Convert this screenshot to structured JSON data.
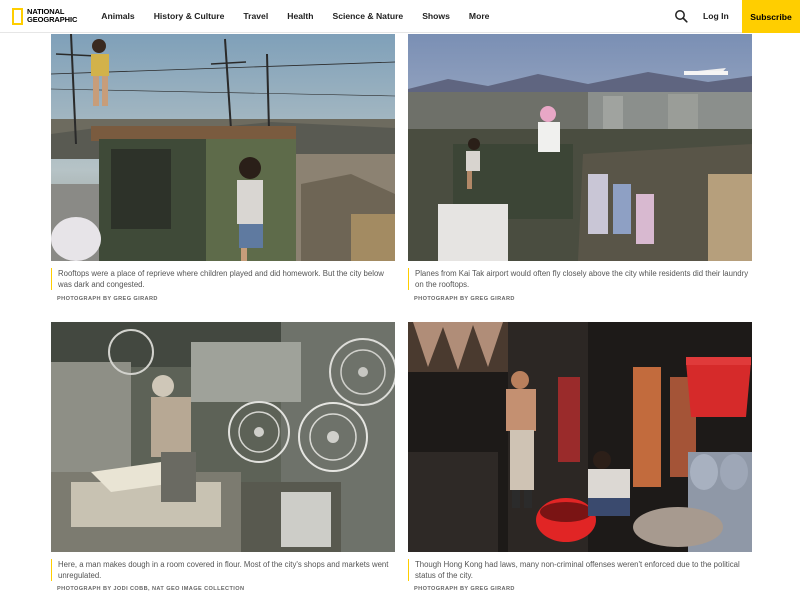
{
  "brand": {
    "logo_line1": "NATIONAL",
    "logo_line2": "GEOGRAPHIC",
    "accent": "#ffce00"
  },
  "nav": {
    "items": [
      "Animals",
      "History & Culture",
      "Travel",
      "Health",
      "Science & Nature",
      "Shows",
      "More"
    ]
  },
  "header": {
    "search_icon": "search-icon",
    "login_label": "Log In",
    "subscribe_label": "Subscribe"
  },
  "gallery": [
    {
      "caption": "Rooftops were a place of reprieve where children played and did homework. But the city below was dark and congested.",
      "credit": "PHOTOGRAPH BY GREG GIRARD"
    },
    {
      "caption": "Planes from Kai Tak airport would often fly closely above the city while residents did their laundry on the rooftops.",
      "credit": "PHOTOGRAPH BY GREG GIRARD"
    },
    {
      "caption": "Here, a man makes dough in a room covered in flour. Most of the city's shops and markets went unregulated.",
      "credit": "PHOTOGRAPH BY JODI COBB, NAT GEO IMAGE COLLECTION"
    },
    {
      "caption": "Though Hong Kong had laws, many non-criminal offenses weren't enforced due to the political status of the city.",
      "credit": "PHOTOGRAPH BY GREG GIRARD"
    }
  ]
}
